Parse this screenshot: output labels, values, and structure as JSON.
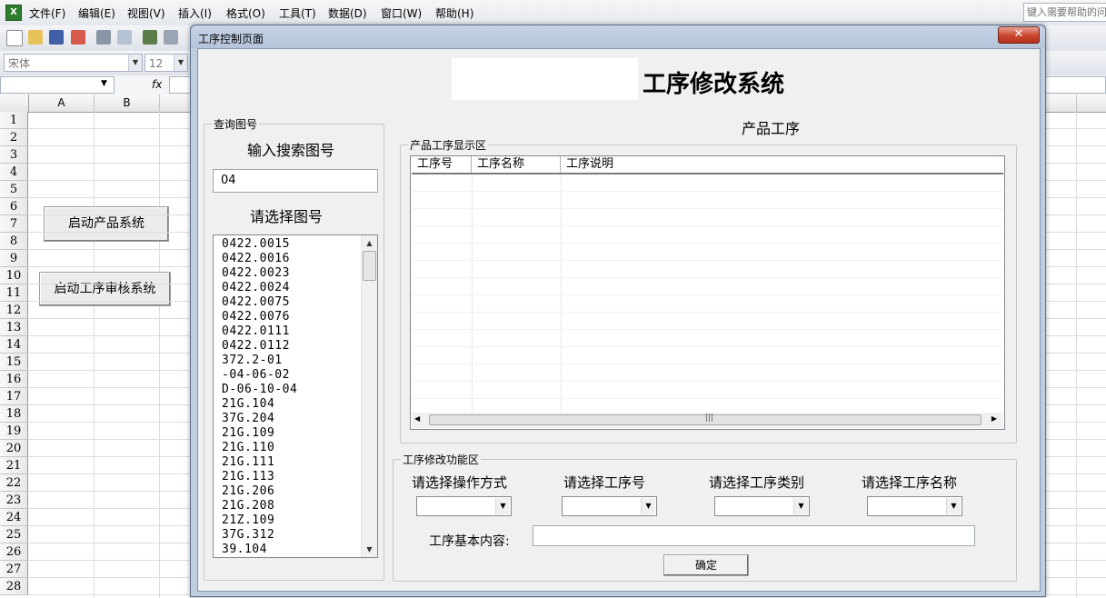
{
  "excel": {
    "menu": [
      "文件(F)",
      "编辑(E)",
      "视图(V)",
      "插入(I)",
      "格式(O)",
      "工具(T)",
      "数据(D)",
      "窗口(W)",
      "帮助(H)"
    ],
    "help_placeholder": "键入需要帮助的问",
    "font_name": "宋体",
    "font_size": "12",
    "fx": "fx",
    "columns": [
      "A",
      "B"
    ],
    "rows": [
      "1",
      "2",
      "3",
      "4",
      "5",
      "6",
      "7",
      "8",
      "9",
      "10",
      "11",
      "12",
      "13",
      "14",
      "15",
      "16",
      "17",
      "18",
      "19",
      "20",
      "21",
      "22",
      "23",
      "24",
      "25",
      "26",
      "27",
      "28"
    ],
    "sheet_buttons": [
      "启动产品系统",
      "启动工序审核系统"
    ]
  },
  "dialog": {
    "window_title": "工序控制页面",
    "heading": "工序修改系统",
    "query_group": {
      "legend": "查询图号",
      "search_label": "输入搜索图号",
      "search_value": "04",
      "select_label": "请选择图号",
      "items": [
        "0422.0015",
        "0422.0016",
        "0422.0023",
        "0422.0024",
        "0422.0075",
        "0422.0076",
        "0422.0111",
        "0422.0112",
        "372.2-01",
        "-04-06-02",
        "D-06-10-04",
        "21G.104",
        "37G.204",
        "21G.109",
        "21G.110",
        "21G.111",
        "21G.113",
        "21G.206",
        "21G.208",
        "21Z.109",
        "37G.312",
        "39.104"
      ]
    },
    "product_process_title": "产品工序",
    "display_group": {
      "legend": "产品工序显示区",
      "columns": [
        "工序号",
        "工序名称",
        "工序说明"
      ]
    },
    "modify_group": {
      "legend": "工序修改功能区",
      "labels": [
        "请选择操作方式",
        "请选择工序号",
        "请选择工序类别",
        "请选择工序名称"
      ],
      "content_label": "工序基本内容:",
      "confirm": "确定"
    }
  }
}
